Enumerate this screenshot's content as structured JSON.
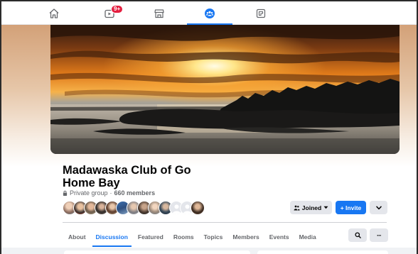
{
  "nav": {
    "items": [
      {
        "name": "home",
        "icon": "home-icon"
      },
      {
        "name": "watch",
        "icon": "video-icon",
        "badge": "9+"
      },
      {
        "name": "marketplace",
        "icon": "marketplace-icon"
      },
      {
        "name": "groups",
        "icon": "groups-icon",
        "active": true
      },
      {
        "name": "gaming",
        "icon": "gaming-icon"
      }
    ],
    "watch_badge": "9+"
  },
  "group": {
    "title": "Madawaska Club of Go Home Bay",
    "privacy": "Private group",
    "separator": "·",
    "members": "660 members"
  },
  "actions": {
    "joined_label": "Joined",
    "invite_label": "+ Invite"
  },
  "tabs": [
    "About",
    "Discussion",
    "Featured",
    "Rooms",
    "Topics",
    "Members",
    "Events",
    "Media"
  ],
  "active_tab": "Discussion",
  "tab_actions": {
    "more_label": "···"
  },
  "colors": {
    "accent": "#1877f2",
    "badge": "#e41e3f",
    "button_gray": "#e4e6eb",
    "secondary_text": "#65676b"
  }
}
